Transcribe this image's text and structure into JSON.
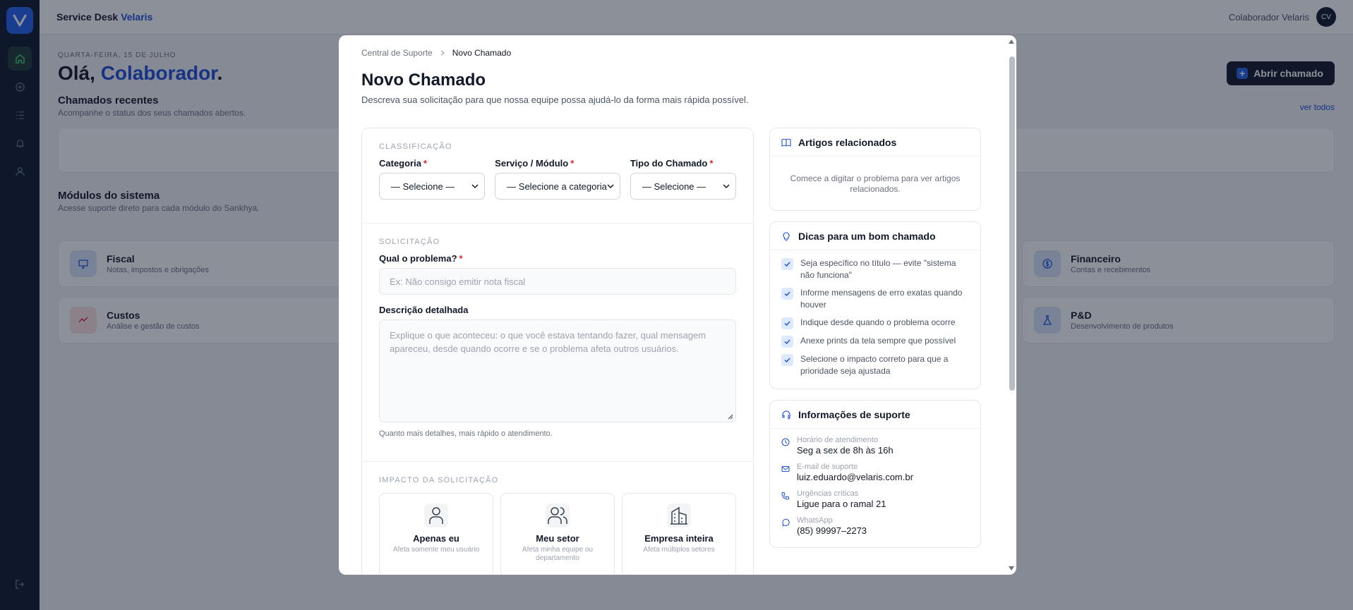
{
  "colors": {
    "accent": "#1d4ed8",
    "sidebar": "#0f1a2b",
    "required": "#dc2626"
  },
  "topbar": {
    "brand": "Service Desk",
    "brand_accent": "Velaris",
    "user_name": "Colaborador Velaris",
    "avatar_initials": "CV"
  },
  "sidebar": {
    "items": [
      "home-icon",
      "plus-circle-icon",
      "list-icon",
      "bell-icon",
      "user-icon"
    ],
    "logout": "logout-icon"
  },
  "page": {
    "date": "QUARTA-FEIRA, 15 DE JULHO",
    "greeting": "Olá,",
    "greeting_name": "Colaborador",
    "greeting_end": ".",
    "open_ticket_label": "Abrir chamado",
    "recent_title": "Chamados recentes",
    "recent_sub": "Acompanhe o status dos seus chamados abertos.",
    "view_all": "ver todos",
    "modules_title": "Módulos do sistema",
    "modules_sub": "Acesse suporte direto para cada módulo do Sankhya.",
    "modules": [
      {
        "name": "Fiscal",
        "desc": "Notas, impostos e obrigações",
        "icon": "monitor-icon",
        "color": "#dbe7fb"
      },
      {
        "name": "Financeiro",
        "desc": "Contas e recebimentos",
        "icon": "dollar-icon",
        "color": "#dbe7fb"
      },
      {
        "name": "Custos",
        "desc": "Análise e gestão de custos",
        "icon": "trend-icon",
        "color": "#fde2e4"
      },
      {
        "name": "P&D",
        "desc": "Desenvolvimento de produtos",
        "icon": "flask-icon",
        "color": "#dbe7fb"
      }
    ]
  },
  "modal": {
    "breadcrumb": [
      "Central de Suporte",
      "Novo Chamado"
    ],
    "title": "Novo Chamado",
    "subtitle": "Descreva sua solicitação para que nossa equipe possa ajudá-lo da forma mais rápida possível.",
    "classification": {
      "label": "CLASSIFICAÇÃO",
      "fields": [
        {
          "label": "Categoria",
          "value": "— Selecione —"
        },
        {
          "label": "Serviço / Módulo",
          "value": "— Selecione a categoria"
        },
        {
          "label": "Tipo do Chamado",
          "value": "— Selecione —"
        }
      ]
    },
    "request": {
      "label": "SOLICITAÇÃO",
      "problem_label": "Qual o problema?",
      "problem_placeholder": "Ex: Não consigo emitir nota fiscal",
      "description_label": "Descrição detalhada",
      "description_placeholder": "Explique o que aconteceu: o que você estava tentando fazer, qual mensagem apareceu, desde quando ocorre e se o problema afeta outros usuários.",
      "hint": "Quanto mais detalhes, mais rápido o atendimento."
    },
    "impact": {
      "label": "IMPACTO DA SOLICITAÇÃO",
      "options": [
        {
          "name": "Apenas eu",
          "desc": "Afeta somente meu usuário",
          "icon": "user-icon"
        },
        {
          "name": "Meu setor",
          "desc": "Afeta minha equipe ou departamento",
          "icon": "users-icon"
        },
        {
          "name": "Empresa inteira",
          "desc": "Afeta múltiplos setores",
          "icon": "building-icon"
        }
      ]
    },
    "articles": {
      "title": "Artigos relacionados",
      "empty": "Comece a digitar o problema para ver artigos relacionados."
    },
    "tips": {
      "title": "Dicas para um bom chamado",
      "items": [
        "Seja específico no título — evite \"sistema não funciona\"",
        "Informe mensagens de erro exatas quando houver",
        "Indique desde quando o problema ocorre",
        "Anexe prints da tela sempre que possível",
        "Selecione o impacto correto para que a prioridade seja ajustada"
      ]
    },
    "support": {
      "title": "Informações de suporte",
      "items": [
        {
          "label": "Horário de atendimento",
          "value": "Seg a sex de 8h às 16h",
          "icon": "clock-icon"
        },
        {
          "label": "E-mail de suporte",
          "value": "luiz.eduardo@velaris.com.br",
          "icon": "mail-icon"
        },
        {
          "label": "Urgências críticas",
          "value": "Ligue para o ramal 21",
          "icon": "phone-icon"
        },
        {
          "label": "WhatsApp",
          "value": "(85) 99997–2273",
          "icon": "whatsapp-icon"
        }
      ]
    }
  }
}
